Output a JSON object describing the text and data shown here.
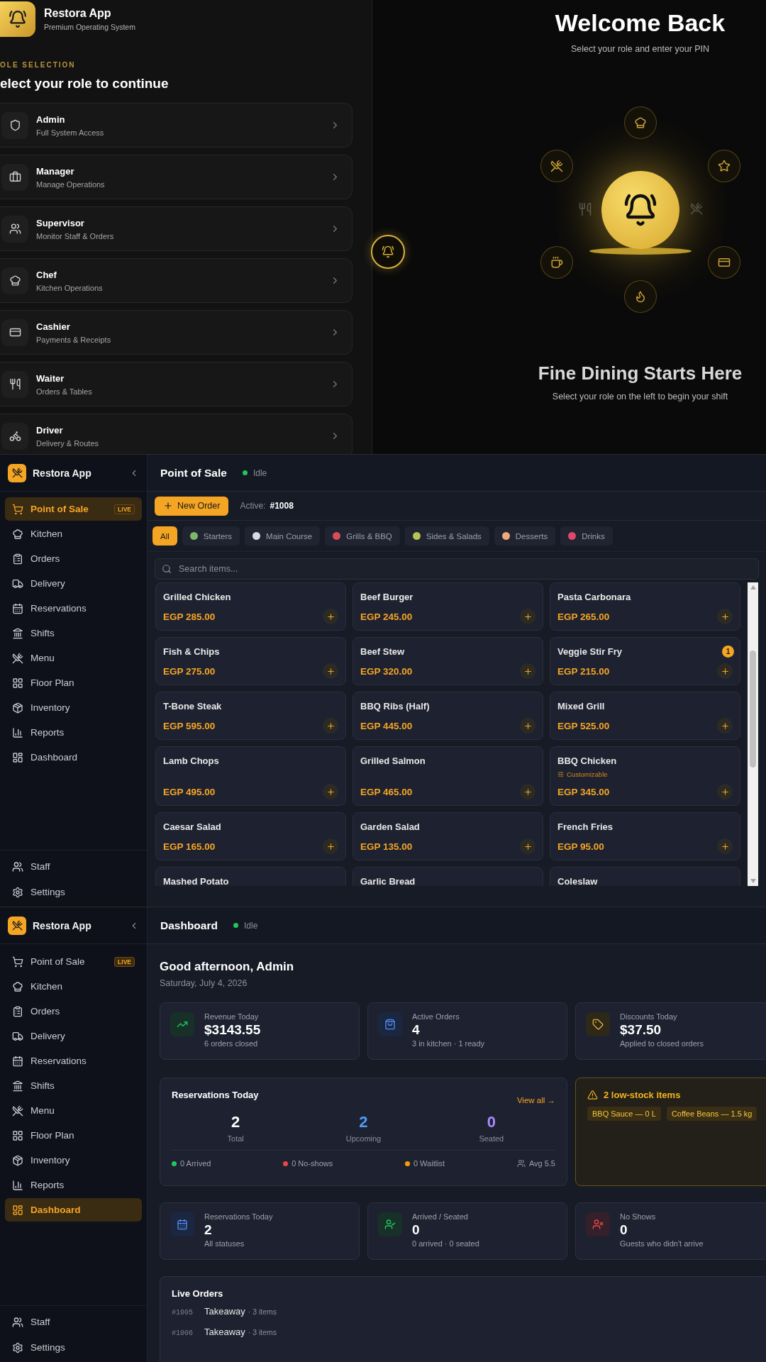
{
  "login": {
    "brand": {
      "name": "Restora App",
      "tagline": "Premium Operating System"
    },
    "section_label": "OLE SELECTION",
    "heading": "elect your role to continue",
    "roles": [
      {
        "name": "Admin",
        "description": "Full System Access"
      },
      {
        "name": "Manager",
        "description": "Manage Operations"
      },
      {
        "name": "Supervisor",
        "description": "Monitor Staff & Orders"
      },
      {
        "name": "Chef",
        "description": "Kitchen Operations"
      },
      {
        "name": "Cashier",
        "description": "Payments & Receipts"
      },
      {
        "name": "Waiter",
        "description": "Orders & Tables"
      },
      {
        "name": "Driver",
        "description": "Delivery & Routes"
      }
    ],
    "welcome": {
      "title": "Welcome Back",
      "subtitle": "Select your role and enter your PIN"
    },
    "hero": {
      "title": "Fine Dining Starts Here",
      "subtitle": "Select your role on the left to begin your shift"
    }
  },
  "pos": {
    "sidebar": {
      "brand": "Restora App",
      "items": [
        {
          "label": "Point of Sale",
          "selected": true,
          "badge": "LIVE"
        },
        {
          "label": "Kitchen",
          "selected": false
        },
        {
          "label": "Orders",
          "selected": false
        },
        {
          "label": "Delivery",
          "selected": false
        },
        {
          "label": "Reservations",
          "selected": false
        },
        {
          "label": "Shifts",
          "selected": false
        },
        {
          "label": "Menu",
          "selected": false
        },
        {
          "label": "Floor Plan",
          "selected": false
        },
        {
          "label": "Inventory",
          "selected": false
        },
        {
          "label": "Reports",
          "selected": false
        },
        {
          "label": "Dashboard",
          "selected": false
        }
      ],
      "footer_items": [
        {
          "label": "Staff"
        },
        {
          "label": "Settings"
        }
      ]
    },
    "header": {
      "title": "Point of Sale",
      "status": "Idle"
    },
    "new_order_button": "New Order",
    "active_label": "Active:",
    "active_order": "#1008",
    "categories": [
      {
        "label": "All",
        "selected": true
      },
      {
        "label": "Starters",
        "selected": false
      },
      {
        "label": "Main Course",
        "selected": false
      },
      {
        "label": "Grills & BBQ",
        "selected": false
      },
      {
        "label": "Sides & Salads",
        "selected": false
      },
      {
        "label": "Desserts",
        "selected": false
      },
      {
        "label": "Drinks",
        "selected": false
      }
    ],
    "search": {
      "placeholder": "Search items..."
    },
    "items": [
      {
        "name": "Grilled Chicken",
        "price": "EGP 285.00"
      },
      {
        "name": "Beef Burger",
        "price": "EGP 245.00"
      },
      {
        "name": "Pasta Carbonara",
        "price": "EGP 265.00"
      },
      {
        "name": "Fish & Chips",
        "price": "EGP 275.00"
      },
      {
        "name": "Beef Stew",
        "price": "EGP 320.00"
      },
      {
        "name": "Veggie Stir Fry",
        "price": "EGP 215.00",
        "qty": "1"
      },
      {
        "name": "T-Bone Steak",
        "price": "EGP 595.00"
      },
      {
        "name": "BBQ Ribs (Half)",
        "price": "EGP 445.00"
      },
      {
        "name": "Mixed Grill",
        "price": "EGP 525.00"
      },
      {
        "name": "Lamb Chops",
        "price": "EGP 495.00"
      },
      {
        "name": "Grilled Salmon",
        "price": "EGP 465.00"
      },
      {
        "name": "BBQ Chicken",
        "price": "EGP 345.00",
        "note": "Customizable"
      },
      {
        "name": "Caesar Salad",
        "price": "EGP 165.00"
      },
      {
        "name": "Garden Salad",
        "price": "EGP 135.00"
      },
      {
        "name": "French Fries",
        "price": "EGP 95.00"
      },
      {
        "name": "Mashed Potato"
      },
      {
        "name": "Garlic Bread"
      },
      {
        "name": "Coleslaw"
      }
    ]
  },
  "dashboard": {
    "sidebar": {
      "brand": "Restora App",
      "items": [
        {
          "label": "Point of Sale",
          "selected": false,
          "badge": "LIVE"
        },
        {
          "label": "Kitchen",
          "selected": false
        },
        {
          "label": "Orders",
          "selected": false
        },
        {
          "label": "Delivery",
          "selected": false
        },
        {
          "label": "Reservations",
          "selected": false
        },
        {
          "label": "Shifts",
          "selected": false
        },
        {
          "label": "Menu",
          "selected": false
        },
        {
          "label": "Floor Plan",
          "selected": false
        },
        {
          "label": "Inventory",
          "selected": false
        },
        {
          "label": "Reports",
          "selected": false
        },
        {
          "label": "Dashboard",
          "selected": true
        }
      ],
      "footer_items": [
        {
          "label": "Staff"
        },
        {
          "label": "Settings"
        }
      ]
    },
    "header": {
      "title": "Dashboard",
      "status": "Idle"
    },
    "greeting": "Good afternoon, Admin",
    "date": "Saturday, July 4, 2026",
    "stats": [
      {
        "kind": "revenue",
        "label": "Revenue Today",
        "value": "$3143.55",
        "note": "6 orders closed"
      },
      {
        "kind": "orders",
        "label": "Active Orders",
        "value": "4",
        "note": "3 in kitchen · 1 ready"
      },
      {
        "kind": "discounts",
        "label": "Discounts Today",
        "value": "$37.50",
        "note": "Applied to closed orders"
      }
    ],
    "reservations": {
      "title": "Reservations Today",
      "link": "View all →",
      "counts": [
        {
          "value": "2",
          "label": "Total",
          "color": "#ffffff"
        },
        {
          "value": "2",
          "label": "Upcoming",
          "color": "#4f9cf9"
        },
        {
          "value": "0",
          "label": "Seated",
          "color": "#a78bfa"
        }
      ],
      "legend": [
        {
          "text": "0 Arrived",
          "color": "#22c55e"
        },
        {
          "text": "0 No-shows",
          "color": "#ef4444"
        },
        {
          "text": "0 Waitlist",
          "color": "#f59e0b"
        }
      ],
      "average": "Avg 5.5"
    },
    "low_stock": {
      "title": "2 low-stock items",
      "tags": [
        "BBQ Sauce — 0 L",
        "Coffee Beans — 1.5 kg"
      ]
    },
    "stats_2": [
      {
        "kind": "reservations",
        "label": "Reservations Today",
        "value": "2",
        "note": "All statuses"
      },
      {
        "kind": "arrived",
        "label": "Arrived / Seated",
        "value": "0",
        "note": "0 arrived · 0 seated"
      },
      {
        "kind": "noshow",
        "label": "No Shows",
        "value": "0",
        "note": "Guests who didn't arrive"
      }
    ],
    "live_orders": {
      "title": "Live Orders",
      "orders": [
        {
          "id": "#1005",
          "type": "Takeaway",
          "detail": "· 3 items"
        },
        {
          "id": "#1006",
          "type": "Takeaway",
          "detail": "· 3 items"
        }
      ]
    }
  }
}
